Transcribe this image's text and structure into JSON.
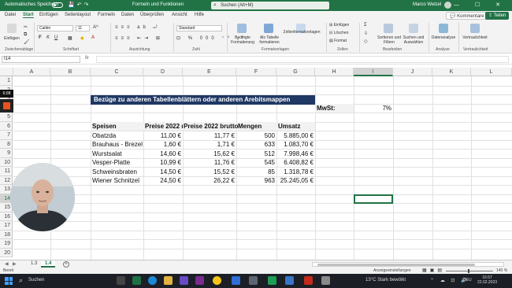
{
  "titlebar": {
    "autosave_label": "Automatisches Speichern",
    "document_title": "Formeln und Funktionen",
    "search_placeholder": "Suchen (Alt+M)",
    "user_name": "Marco Welzel",
    "window_controls": "— ☐ ✕"
  },
  "menu": {
    "tabs": [
      "Datei",
      "Start",
      "Einfügen",
      "Seitenlayout",
      "Formeln",
      "Daten",
      "Überprüfen",
      "Ansicht",
      "Hilfe"
    ],
    "active_tab": "Start",
    "comments_label": "Kommentare",
    "share_label": "Teilen"
  },
  "ribbon": {
    "font_name": "Calibri",
    "font_size": "11",
    "number_format": "Standard",
    "groups": {
      "clipboard": "Zwischenablage",
      "font": "Schriftart",
      "alignment": "Ausrichtung",
      "number": "Zahl",
      "styles": "Formatvorlagen",
      "cells": "Zellen",
      "editing": "Bearbeiten",
      "analysis": "Analyse",
      "sensitivity": "Vertraulichkeit"
    },
    "buttons": {
      "paste": "Einfügen",
      "conditional": "Bedingte Formatierung",
      "as_table": "Als Tabelle formatieren",
      "cell_styles": "Zellenformatvorlagen",
      "insert": "Einfügen",
      "delete": "Löschen",
      "format": "Format",
      "sort_filter": "Sortieren und Filtern",
      "find_select": "Suchen und Auswählen",
      "data_analysis": "Datenanalyse",
      "sensitivity": "Vertraulichkeit"
    }
  },
  "formula_bar": {
    "name_box": "I14",
    "fx": "fx",
    "formula": ""
  },
  "grid": {
    "columns": [
      "A",
      "B",
      "C",
      "D",
      "E",
      "F",
      "G",
      "H",
      "I",
      "J",
      "K",
      "L"
    ],
    "rows": [
      "1",
      "2",
      "3",
      "4",
      "5",
      "6",
      "7",
      "8",
      "9",
      "10",
      "11",
      "12",
      "13",
      "14",
      "15",
      "16",
      "17",
      "18",
      "19",
      "20"
    ],
    "selected_column": "I",
    "selected_row": "14",
    "banner": "Bezüge zu anderen Tabellenblättern oder anderen Arebitsmappen erstellen",
    "vat_label": "MwSt:",
    "vat_value": "7%",
    "headers": [
      "Speisen",
      "Preise 2022 n",
      "Preise 2022 brutto",
      "Mengen",
      "Umsatz"
    ],
    "table": [
      [
        "Obatzda",
        "11,00 €",
        "11,77 €",
        "500",
        "5.885,00 €"
      ],
      [
        "Brauhaus - Brezel",
        "1,60 €",
        "1,71 €",
        "633",
        "1.083,70 €"
      ],
      [
        "Wurstsalat",
        "14,60 €",
        "15,62 €",
        "512",
        "7.998,46 €"
      ],
      [
        "Vesper-Platte",
        "10,99 €",
        "11,76 €",
        "545",
        "6.408,82 €"
      ],
      [
        "Schweinsbraten",
        "14,50 €",
        "15,52 €",
        "85",
        "1.318,78 €"
      ],
      [
        "Wiener Schnitzel",
        "24,50 €",
        "26,22 €",
        "963",
        "25.245,05 €"
      ]
    ]
  },
  "sheets": {
    "tabs": [
      "1.3",
      "1.4"
    ],
    "active": "1.4",
    "add_label": "+"
  },
  "status": {
    "ready": "Bereit",
    "display_settings": "Anzeigeeinstellungen",
    "zoom": "140 %"
  },
  "taskbar": {
    "search_label": "Suchen",
    "weather": "13°C  Stark bewölkt",
    "language": "DEU",
    "time": "16:57",
    "date": "22.02.2023"
  },
  "overlay": {
    "rec_time": "6:08"
  },
  "colors": {
    "excel_green": "#217346",
    "banner_blue": "#1f3864",
    "taskbar": "#1c1f26"
  }
}
